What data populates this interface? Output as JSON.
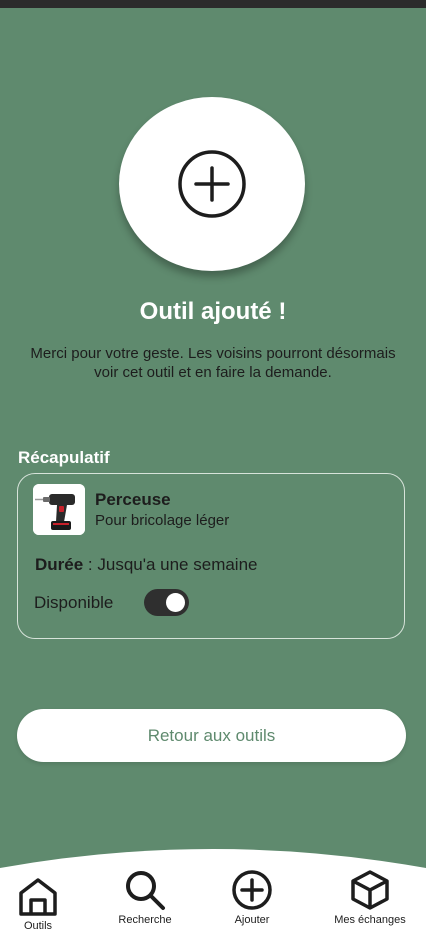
{
  "confirmation": {
    "icon": "plus-circle-icon",
    "title": "Outil ajouté !",
    "message": "Merci pour votre geste. Les voisins pourront désormais voir cet outil et en faire la demande."
  },
  "recap": {
    "label": "Récapulatif",
    "tool": {
      "image": "drill-photo",
      "name": "Perceuse",
      "description": "Pour bricolage léger"
    },
    "duration_label": "Durée",
    "duration_separator": " : ",
    "duration_value": "Jusqu'a une semaine",
    "availability_label": "Disponible",
    "availability_on": true
  },
  "back_button_label": "Retour aux outils",
  "nav": {
    "items": [
      {
        "label": "Outils",
        "icon": "home-icon"
      },
      {
        "label": "Recherche",
        "icon": "search-icon"
      },
      {
        "label": "Ajouter",
        "icon": "plus-circle-icon"
      },
      {
        "label": "Mes échanges",
        "icon": "box-icon"
      }
    ]
  },
  "colors": {
    "background": "#5f8a6e",
    "card_border": "#d7e3da",
    "text_dark": "#1d1d1d",
    "white": "#ffffff",
    "toggle_on": "#2f2f2f"
  }
}
